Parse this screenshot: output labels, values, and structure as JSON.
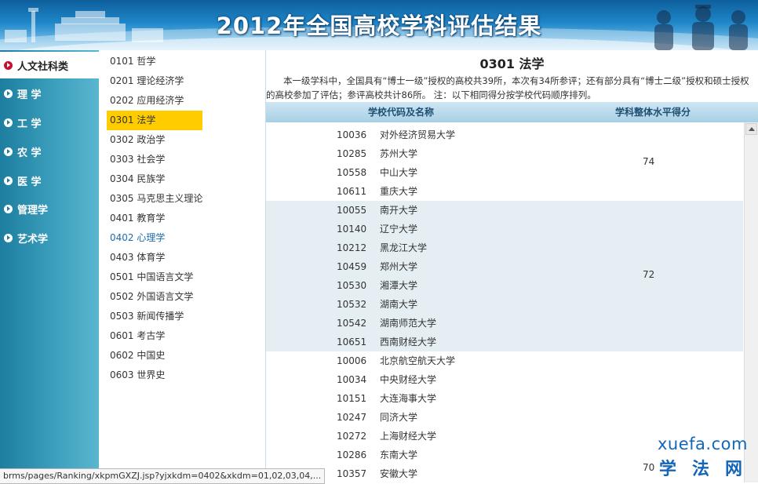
{
  "header": {
    "title": "2012年全国高校学科评估结果"
  },
  "categories": [
    {
      "label": "人文社科类",
      "active": true
    },
    {
      "label": "理  学",
      "active": false
    },
    {
      "label": "工  学",
      "active": false
    },
    {
      "label": "农  学",
      "active": false
    },
    {
      "label": "医  学",
      "active": false
    },
    {
      "label": "管理学",
      "active": false
    },
    {
      "label": "艺术学",
      "active": false
    }
  ],
  "subjects": [
    {
      "label": "0101 哲学",
      "state": ""
    },
    {
      "label": "0201 理论经济学",
      "state": ""
    },
    {
      "label": "0202 应用经济学",
      "state": ""
    },
    {
      "label": "0301 法学",
      "state": "selected"
    },
    {
      "label": "0302 政治学",
      "state": ""
    },
    {
      "label": "0303 社会学",
      "state": ""
    },
    {
      "label": "0304 民族学",
      "state": ""
    },
    {
      "label": "0305 马克思主义理论",
      "state": ""
    },
    {
      "label": "0401 教育学",
      "state": ""
    },
    {
      "label": "0402 心理学",
      "state": "hovered"
    },
    {
      "label": "0403 体育学",
      "state": ""
    },
    {
      "label": "0501 中国语言文学",
      "state": ""
    },
    {
      "label": "0502 外国语言文学",
      "state": ""
    },
    {
      "label": "0503 新闻传播学",
      "state": ""
    },
    {
      "label": "0601 考古学",
      "state": ""
    },
    {
      "label": "0602 中国史",
      "state": ""
    },
    {
      "label": "0603 世界史",
      "state": ""
    }
  ],
  "main": {
    "title": "0301 法学",
    "intro": "本一级学科中，全国具有“博士一级”授权的高校共39所，本次有34所参评；还有部分具有“博士二级”授权和硕士授权的高校参加了评估；参评高校共计86所。 注：以下相同得分按学校代码顺序排列。",
    "col_school": "学校代码及名称",
    "col_score": "学科整体水平得分"
  },
  "groups": [
    {
      "score": "74",
      "shaded": false,
      "rows": [
        {
          "code": "10036",
          "name": "对外经济贸易大学"
        },
        {
          "code": "10285",
          "name": "苏州大学"
        },
        {
          "code": "10558",
          "name": "中山大学"
        },
        {
          "code": "10611",
          "name": "重庆大学"
        }
      ]
    },
    {
      "score": "72",
      "shaded": true,
      "rows": [
        {
          "code": "10055",
          "name": "南开大学"
        },
        {
          "code": "10140",
          "name": "辽宁大学"
        },
        {
          "code": "10212",
          "name": "黑龙江大学"
        },
        {
          "code": "10459",
          "name": "郑州大学"
        },
        {
          "code": "10530",
          "name": "湘潭大学"
        },
        {
          "code": "10532",
          "name": "湖南大学"
        },
        {
          "code": "10542",
          "name": "湖南师范大学"
        },
        {
          "code": "10651",
          "name": "西南财经大学"
        }
      ]
    },
    {
      "score": "70",
      "shaded": false,
      "rows": [
        {
          "code": "10006",
          "name": "北京航空航天大学"
        },
        {
          "code": "10034",
          "name": "中央财经大学"
        },
        {
          "code": "10151",
          "name": "大连海事大学"
        },
        {
          "code": "10247",
          "name": "同济大学"
        },
        {
          "code": "10272",
          "name": "上海财经大学"
        },
        {
          "code": "10286",
          "name": "东南大学"
        },
        {
          "code": "10357",
          "name": "安徽大学"
        }
      ]
    }
  ],
  "status_bar": {
    "url": "brms/pages/Ranking/xkpmGXZJ.jsp?yjxkdm=0402&xkdm=01,02,03,04,..."
  },
  "watermark": {
    "domain": "xuefa.com",
    "chars": "学法网"
  },
  "colors": {
    "selected": "#ffcc00",
    "link_hover": "#1a6db3",
    "nav_bg": "#3fa2c0",
    "shaded_row": "#e4eef3"
  }
}
